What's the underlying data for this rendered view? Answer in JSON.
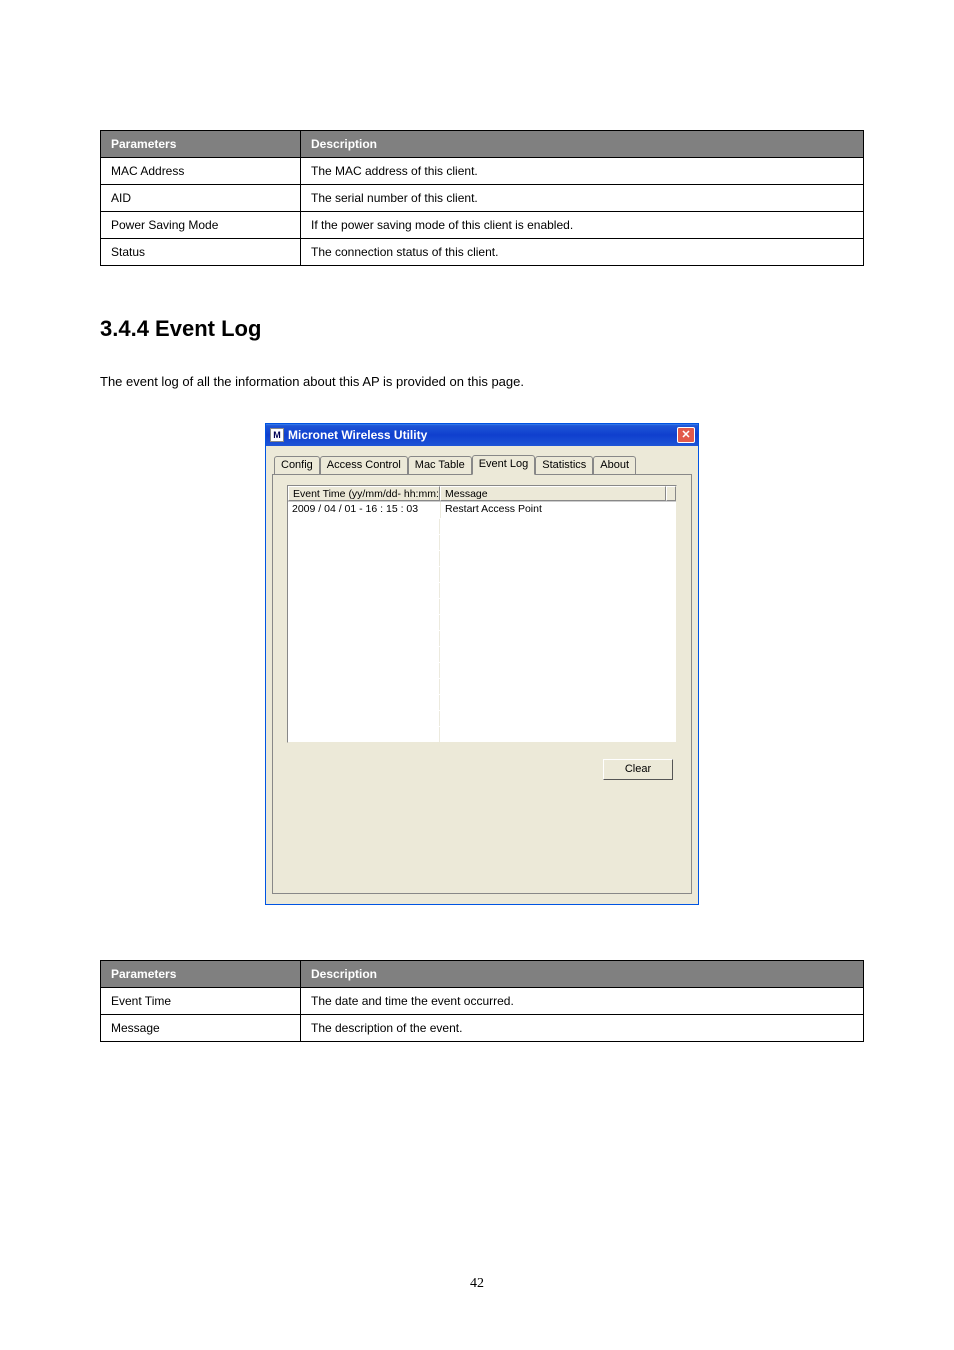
{
  "top_table": {
    "headers": [
      "Parameters",
      "Description"
    ],
    "rows": [
      [
        "MAC Address",
        "The MAC address of this client."
      ],
      [
        "AID",
        "The serial number of this client."
      ],
      [
        "Power Saving Mode",
        "If the power saving mode of this client is enabled."
      ],
      [
        "Status",
        "The connection status of this client."
      ]
    ]
  },
  "section": {
    "heading": "3.4.4  Event Log",
    "desc": "The event log of all the information about this AP is provided on this page."
  },
  "window": {
    "title": "Micronet Wireless Utility",
    "tabs": [
      "Config",
      "Access Control",
      "Mac Table",
      "Event Log",
      "Statistics",
      "About"
    ],
    "active_tab": 3,
    "event_headers": [
      "Event Time (yy/mm/dd- hh:mm:ss)",
      "Message"
    ],
    "event_row": {
      "time": "2009 / 04 / 01 - 16 : 15 : 03",
      "msg": "Restart Access Point"
    },
    "clear_label": "Clear"
  },
  "bottom_table": {
    "headers": [
      "Parameters",
      "Description"
    ],
    "rows": [
      [
        "Event Time",
        "The date and time the event occurred."
      ],
      [
        "Message",
        "The description of the event."
      ]
    ]
  },
  "page_number": "42"
}
